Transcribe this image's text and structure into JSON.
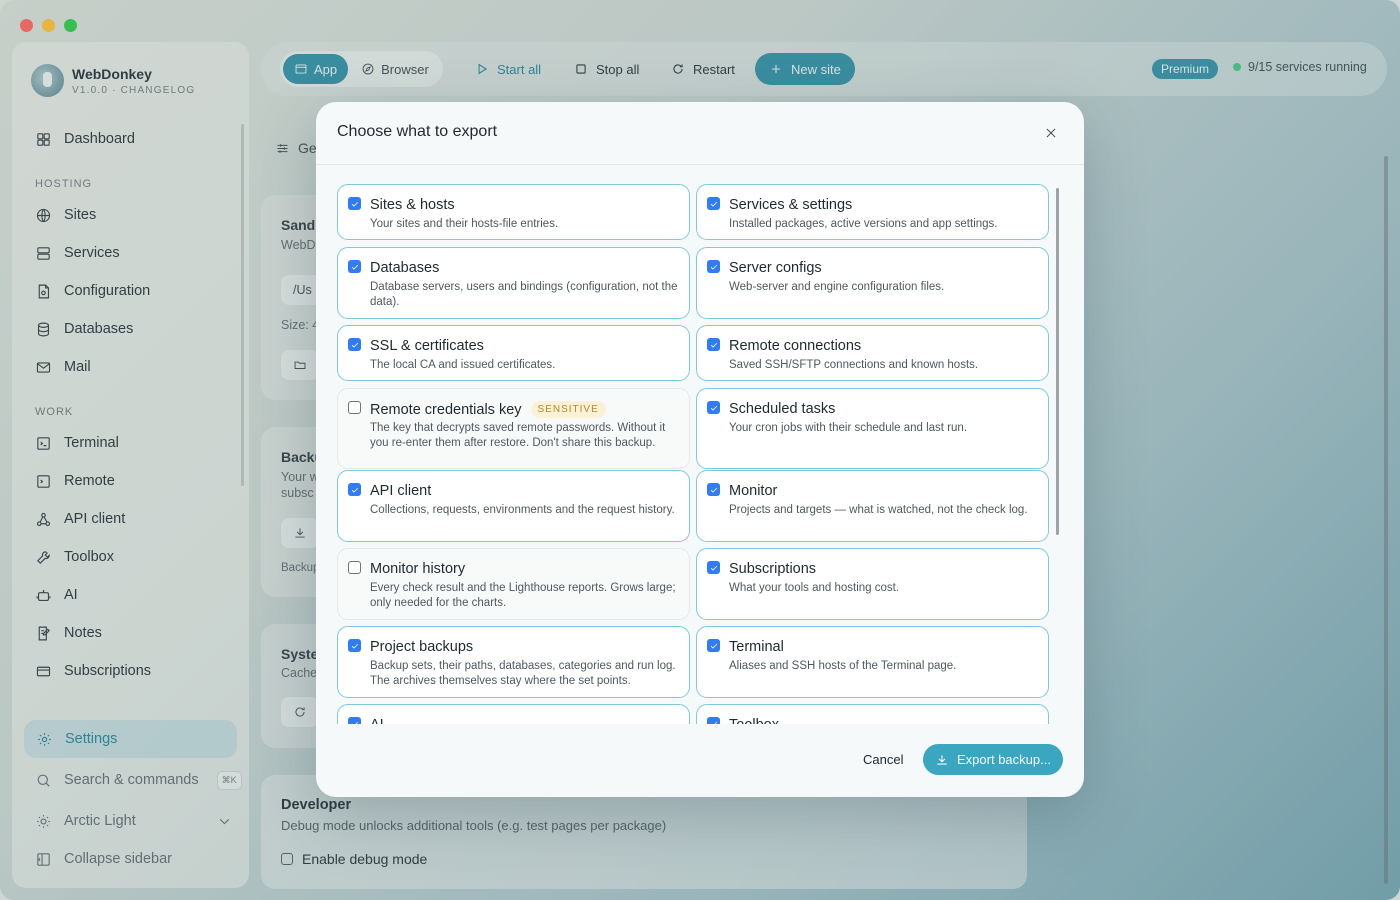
{
  "app": {
    "name": "WebDonkey",
    "version_line": "V1.0.0 · CHANGELOG"
  },
  "sidebar": {
    "top_item": {
      "label": "Dashboard",
      "icon": "dashboard-icon"
    },
    "hosting_heading": "HOSTING",
    "hosting": [
      {
        "label": "Sites",
        "icon": "globe-icon"
      },
      {
        "label": "Services",
        "icon": "server-icon"
      },
      {
        "label": "Configuration",
        "icon": "config-file-icon"
      },
      {
        "label": "Databases",
        "icon": "database-icon"
      },
      {
        "label": "Mail",
        "icon": "mail-icon"
      }
    ],
    "work_heading": "WORK",
    "work": [
      {
        "label": "Terminal",
        "icon": "terminal-icon"
      },
      {
        "label": "Remote",
        "icon": "remote-icon"
      },
      {
        "label": "API client",
        "icon": "api-icon"
      },
      {
        "label": "Toolbox",
        "icon": "wrench-icon"
      },
      {
        "label": "AI",
        "icon": "robot-icon"
      },
      {
        "label": "Notes",
        "icon": "notes-icon"
      },
      {
        "label": "Subscriptions",
        "icon": "card-icon"
      }
    ],
    "settings": {
      "label": "Settings",
      "icon": "gear-icon"
    },
    "search": {
      "label": "Search & commands",
      "shortcut": "⌘K"
    },
    "theme": {
      "label": "Arctic Light"
    },
    "collapse": {
      "label": "Collapse sidebar"
    }
  },
  "toolbar": {
    "tab_app": "App",
    "tab_browser": "Browser",
    "start_all": "Start all",
    "stop_all": "Stop all",
    "restart": "Restart",
    "new_site": "New site",
    "plan_badge": "Premium",
    "services_status": "9/15 services running"
  },
  "background": {
    "heading_fragment": "Ge",
    "card1": {
      "title_fragment": "Sandl",
      "sub_fragment": "WebD",
      "path_fragment": "/Us",
      "size_fragment": "Size: 4"
    },
    "card2": {
      "title_fragment": "Backu",
      "sub1_fragment": "Your w",
      "sub2_fragment": "subsc",
      "foot_fragment": "Backup"
    },
    "card3": {
      "title_fragment": "Syste",
      "sub_fragment": "Cache"
    },
    "developer": {
      "title": "Developer",
      "description": "Debug mode unlocks additional tools (e.g. test pages per package)",
      "checkbox_label": "Enable debug mode"
    }
  },
  "modal": {
    "title": "Choose what to export",
    "options": [
      {
        "title": "Sites & hosts",
        "desc": "Your sites and their hosts-file entries.",
        "checked": true
      },
      {
        "title": "Services & settings",
        "desc": "Installed packages, active versions and app settings.",
        "checked": true
      },
      {
        "title": "Databases",
        "desc": "Database servers, users and bindings (configuration, not the data).",
        "checked": true
      },
      {
        "title": "Server configs",
        "desc": "Web-server and engine configuration files.",
        "checked": true
      },
      {
        "title": "SSL & certificates",
        "desc": "The local CA and issued certificates.",
        "checked": true
      },
      {
        "title": "Remote connections",
        "desc": "Saved SSH/SFTP connections and known hosts.",
        "checked": true
      },
      {
        "title": "Remote credentials key",
        "badge": "SENSITIVE",
        "desc": "The key that decrypts saved remote passwords. Without it you re-enter them after restore. Don't share this backup.",
        "checked": false
      },
      {
        "title": "Scheduled tasks",
        "desc": "Your cron jobs with their schedule and last run.",
        "checked": true
      },
      {
        "title": "API client",
        "desc": "Collections, requests, environments and the request history.",
        "checked": true
      },
      {
        "title": "Monitor",
        "desc": "Projects and targets — what is watched, not the check log.",
        "checked": true
      },
      {
        "title": "Monitor history",
        "desc": "Every check result and the Lighthouse reports. Grows large; only needed for the charts.",
        "checked": false
      },
      {
        "title": "Subscriptions",
        "desc": "What your tools and hosting cost.",
        "checked": true
      },
      {
        "title": "Project backups",
        "desc": "Backup sets, their paths, databases, categories and run log. The archives themselves stay where the set points.",
        "checked": true
      },
      {
        "title": "Terminal",
        "desc": "Aliases and SSH hosts of the Terminal page.",
        "checked": true
      },
      {
        "title": "AI",
        "desc": "",
        "checked": true
      },
      {
        "title": "Toolbox",
        "desc": "",
        "checked": true
      }
    ],
    "cancel": "Cancel",
    "export": "Export backup..."
  }
}
